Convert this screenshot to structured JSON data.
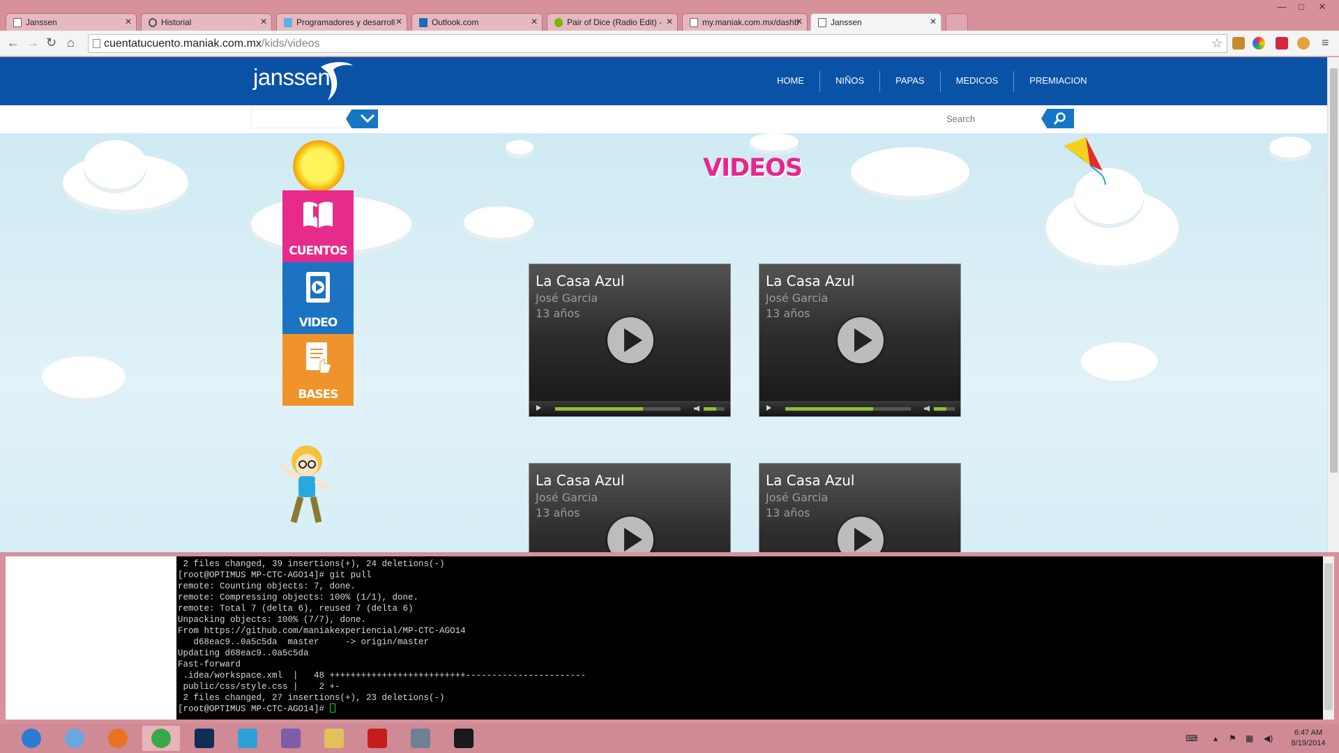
{
  "browser": {
    "tabs": [
      {
        "title": "Janssen",
        "active": false
      },
      {
        "title": "Historial",
        "active": false
      },
      {
        "title": "Programadores y desarroll",
        "active": false
      },
      {
        "title": "Outlook.com",
        "active": false
      },
      {
        "title": "Pair of Dice (Radio Edit) -",
        "active": false
      },
      {
        "title": "my.maniak.com.mx/dashb",
        "active": false
      },
      {
        "title": "Janssen",
        "active": true
      }
    ],
    "url_host": "cuentatucuento.maniak.com.mx",
    "url_path": "/kids/videos",
    "window_controls": {
      "minimize": "—",
      "maximize": "□",
      "close": "✕"
    }
  },
  "site": {
    "logo": "janssen",
    "nav": [
      "HOME",
      "NIÑOS",
      "PAPAS",
      "MEDICOS",
      "PREMIACION"
    ],
    "search_placeholder": "Search",
    "page_title": "VIDEOS",
    "side_menu": [
      {
        "label": "CUENTOS",
        "color": "#e62b8a"
      },
      {
        "label": "VIDEO",
        "color": "#1b73c1"
      },
      {
        "label": "BASES",
        "color": "#f0932a"
      }
    ],
    "videos": [
      {
        "title": "La Casa Azul",
        "author": "José Garcia",
        "age": "13 años",
        "progress": 0.7,
        "volume": 0.6
      },
      {
        "title": "La Casa Azul",
        "author": "José Garcia",
        "age": "13 años",
        "progress": 0.7,
        "volume": 0.6
      },
      {
        "title": "La Casa Azul",
        "author": "José Garcia",
        "age": "13 años",
        "progress": 0.7,
        "volume": 0.6
      },
      {
        "title": "La Casa Azul",
        "author": "José Garcia",
        "age": "13 años",
        "progress": 0.7,
        "volume": 0.6
      }
    ]
  },
  "terminal": {
    "lines": [
      " 2 files changed, 39 insertions(+), 24 deletions(-)",
      "[root@OPTIMUS MP-CTC-AGO14]# git pull",
      "remote: Counting objects: 7, done.",
      "remote: Compressing objects: 100% (1/1), done.",
      "remote: Total 7 (delta 6), reused 7 (delta 6)",
      "Unpacking objects: 100% (7/7), done.",
      "From https://github.com/maniakexperiencial/MP-CTC-AGO14",
      "   d68eac9..0a5c5da  master     -> origin/master",
      "Updating d68eac9..0a5c5da",
      "Fast-forward",
      " .idea/workspace.xml  |   48 ++++++++++++++++++++++++++-----------------------",
      " public/css/style.css |    2 +-",
      " 2 files changed, 27 insertions(+), 23 deletions(-)"
    ],
    "prompt": "[root@OPTIMUS MP-CTC-AGO14]# "
  },
  "taskbar": {
    "apps": [
      {
        "name": "internet-explorer",
        "color": "#2b7bd6"
      },
      {
        "name": "safari",
        "color": "#6aa6e0"
      },
      {
        "name": "firefox",
        "color": "#e8731e"
      },
      {
        "name": "chrome",
        "color": "#3aa84a"
      },
      {
        "name": "photoshop",
        "color": "#0f2d56"
      },
      {
        "name": "telegram",
        "color": "#2ea0d8"
      },
      {
        "name": "php",
        "color": "#7b5da8"
      },
      {
        "name": "file-explorer",
        "color": "#e3c05a"
      },
      {
        "name": "acrobat",
        "color": "#c71c1c"
      },
      {
        "name": "calculator",
        "color": "#6e7f96"
      },
      {
        "name": "terminal",
        "color": "#1a1a1a"
      }
    ],
    "time": "6:47 AM",
    "date": "8/19/2014"
  }
}
